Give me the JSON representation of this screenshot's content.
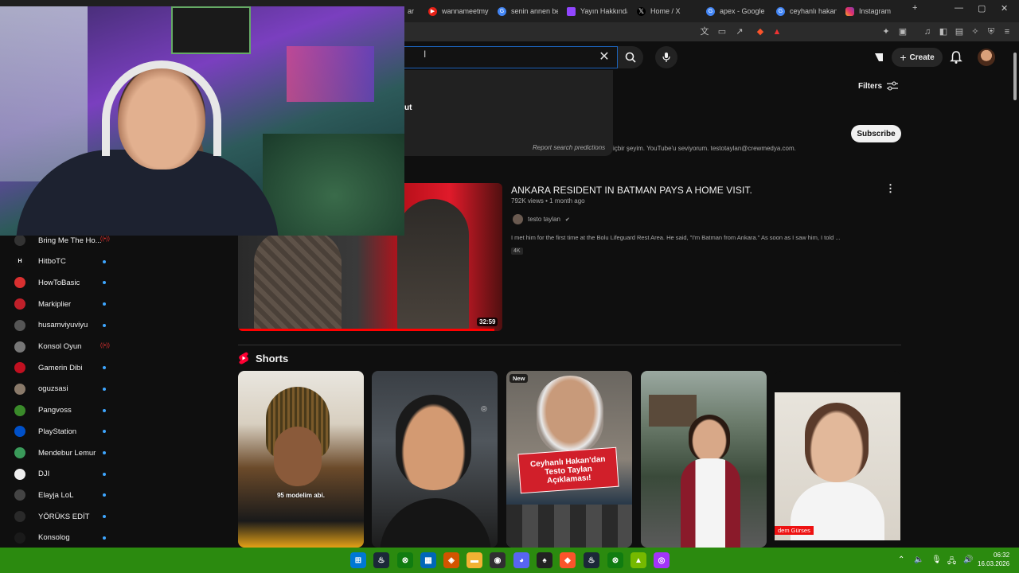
{
  "browser": {
    "tabs": [
      {
        "label": "ar",
        "color": "#666666"
      },
      {
        "label": "wannameetmy",
        "color": "#e62117"
      },
      {
        "label": "senin annen be",
        "color": "#4285f4"
      },
      {
        "label": "Yayın Hakkında",
        "color": "#9146ff"
      },
      {
        "label": "Home / X",
        "color": "#000000"
      },
      {
        "label": "apex - Google",
        "color": "#4285f4"
      },
      {
        "label": "ceyhanlı hakan",
        "color": "#4285f4"
      },
      {
        "label": "Instagram",
        "color": "#e1306c"
      }
    ],
    "new_tab": "+",
    "window_controls": [
      "—",
      "▢",
      "✕"
    ]
  },
  "youtube": {
    "search_value": "",
    "search_fragment": "ut",
    "report_predictions": "Report search predictions",
    "create_label": "Create",
    "filters_label": "Filters",
    "subscribe_label": "Subscribe",
    "channel_desc_fragment": "içbir şeyim. YouTube'u seviyorum. testotaylan@crewmedya.com.",
    "video": {
      "title": "ANKARA RESIDENT IN BATMAN PAYS A HOME VISIT.",
      "meta": "792K views • 1 month ago",
      "channel": "testo taylan",
      "verified": "✔",
      "description": "I met him for the first time at the Bolu Lifeguard Rest Area. He said, \"I'm Batman from Ankara.\" As soon as I saw him, I told ...",
      "badge": "4K",
      "duration": "32:59",
      "progress": 0.97
    },
    "shorts_label": "Shorts",
    "shorts": [
      {
        "overlay": "95 modelim abi.",
        "badge": ""
      },
      {
        "overlay": "",
        "badge": ""
      },
      {
        "overlay": "",
        "badge": "New",
        "banner_line1": "Ceyhanlı Hakan'dan",
        "banner_line2": "Testo Taylan",
        "banner_line3": "Açıklaması!"
      },
      {
        "overlay": "",
        "badge": ""
      },
      {
        "overlay": "",
        "badge": "",
        "name_tag": "dem Gürses"
      }
    ]
  },
  "sidebar": {
    "channels": [
      {
        "name": "Bring Me The Ho...",
        "color": "#333333",
        "initial": "",
        "status": "live"
      },
      {
        "name": "HitboTC",
        "color": "#111111",
        "initial": "H",
        "status": "new"
      },
      {
        "name": "HowToBasic",
        "color": "#d93030",
        "initial": "",
        "status": "new"
      },
      {
        "name": "Markiplier",
        "color": "#c0202a",
        "initial": "",
        "status": "new"
      },
      {
        "name": "husamviyuviyu",
        "color": "#555555",
        "initial": "",
        "status": "new"
      },
      {
        "name": "Konsol Oyun",
        "color": "#777777",
        "initial": "",
        "status": "live"
      },
      {
        "name": "Gamerin Dibi",
        "color": "#c01020",
        "initial": "",
        "status": "new"
      },
      {
        "name": "oguzsasi",
        "color": "#8a7a6a",
        "initial": "",
        "status": "new"
      },
      {
        "name": "Pangvoss",
        "color": "#3a8a2a",
        "initial": "",
        "status": "new"
      },
      {
        "name": "PlayStation",
        "color": "#0050c8",
        "initial": "",
        "status": "new"
      },
      {
        "name": "Mendebur Lemur",
        "color": "#3a9a5a",
        "initial": "",
        "status": "new"
      },
      {
        "name": "DJI",
        "color": "#eeeeee",
        "initial": "",
        "status": "new"
      },
      {
        "name": "Elayja LoL",
        "color": "#444444",
        "initial": "",
        "status": "new"
      },
      {
        "name": "YÖRÜKS EDİT",
        "color": "#2a2a2a",
        "initial": "",
        "status": "new"
      },
      {
        "name": "Konsolog",
        "color": "#1a1a1a",
        "initial": "",
        "status": "new"
      }
    ],
    "live_symbol": "((•))"
  },
  "taskbar": {
    "time": "06:32",
    "date": "16.03.2026",
    "apps": [
      {
        "name": "start",
        "color": "#0078d4"
      },
      {
        "name": "steam",
        "color": "#1b2838"
      },
      {
        "name": "xbox",
        "color": "#107c10"
      },
      {
        "name": "store",
        "color": "#0067b8"
      },
      {
        "name": "browser-orange",
        "color": "#d35400"
      },
      {
        "name": "files",
        "color": "#f2b233"
      },
      {
        "name": "obs",
        "color": "#302e31"
      },
      {
        "name": "discord",
        "color": "#5865f2"
      },
      {
        "name": "game",
        "color": "#222222"
      },
      {
        "name": "brave",
        "color": "#fb542b"
      },
      {
        "name": "steam2",
        "color": "#1b2838"
      },
      {
        "name": "xbox2",
        "color": "#107c10"
      },
      {
        "name": "nvidia",
        "color": "#76b900"
      },
      {
        "name": "messenger",
        "color": "#a334fa"
      }
    ]
  }
}
